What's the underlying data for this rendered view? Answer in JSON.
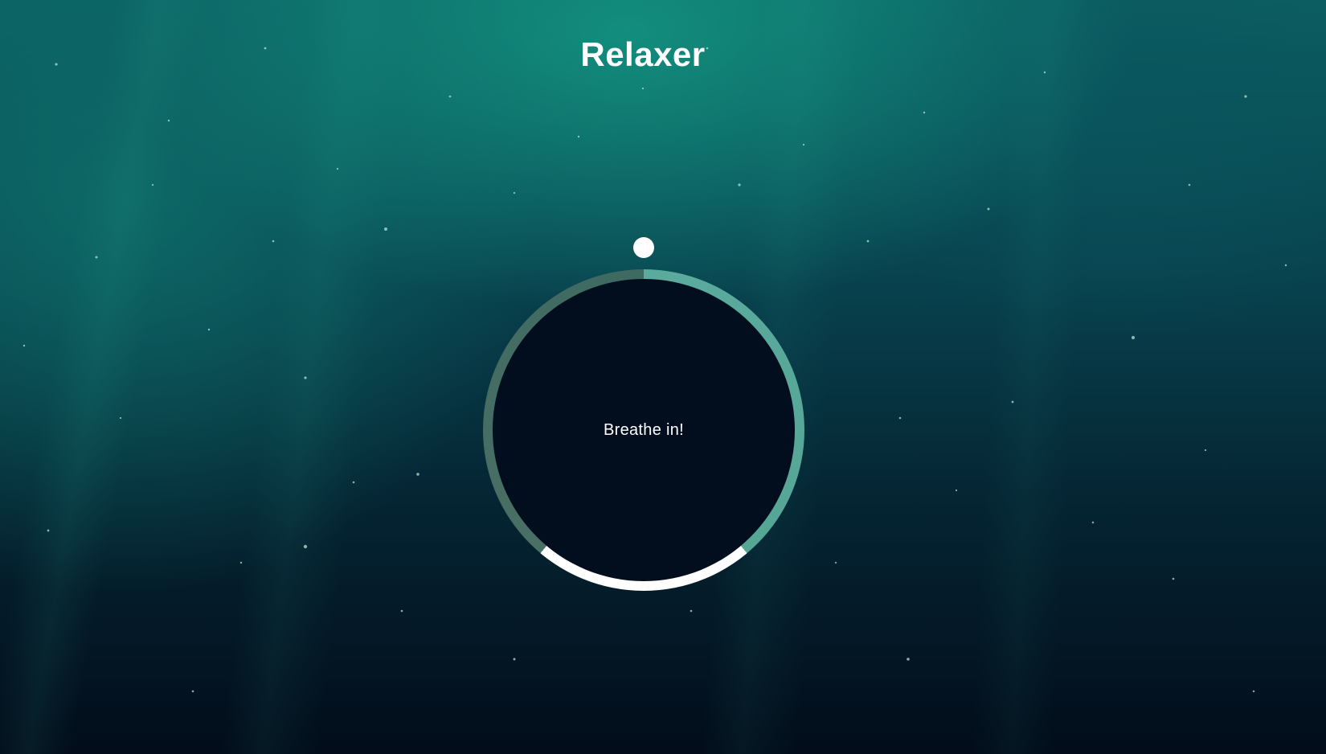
{
  "app": {
    "title": "Relaxer"
  },
  "breath": {
    "status_text": "Breathe in!"
  },
  "colors": {
    "ring_breathe_in": "#5aaa9e",
    "ring_hold": "#ffffff",
    "ring_breathe_out": "#3e6a62",
    "circle_fill": "#020d1d",
    "pointer": "#ffffff"
  },
  "icons": {
    "pointer": "pointer-dot-icon"
  }
}
